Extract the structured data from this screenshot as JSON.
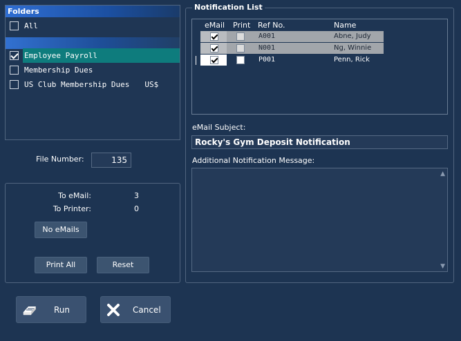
{
  "folders": {
    "header": "Folders",
    "items": [
      {
        "label": "All",
        "checked": false
      },
      {
        "label": "Employee Payroll",
        "checked": true,
        "selected": true
      },
      {
        "label": "Membership Dues",
        "checked": false
      },
      {
        "label": "US Club Membership Dues",
        "suffix": "US$",
        "checked": false
      }
    ]
  },
  "file_number": {
    "label": "File Number:",
    "value": "135"
  },
  "counts": {
    "to_email_label": "To eMail:",
    "to_email_value": "3",
    "to_printer_label": "To Printer:",
    "to_printer_value": "0",
    "no_emails_label": "No eMails",
    "print_all_label": "Print All",
    "reset_label": "Reset"
  },
  "notification_list": {
    "title": "Notification List",
    "columns": [
      "eMail",
      "Print",
      "Ref No.",
      "Name"
    ],
    "rows": [
      {
        "email": true,
        "print": false,
        "ref": "A001",
        "name": "Abne, Judy"
      },
      {
        "email": true,
        "print": false,
        "ref": "N001",
        "name": "Ng, Winnie"
      },
      {
        "email": true,
        "print": false,
        "ref": "P001",
        "name": "Penn, Rick"
      }
    ]
  },
  "email_subject": {
    "label": "eMail Subject:",
    "value": "Rocky's Gym Deposit Notification"
  },
  "additional_message": {
    "label": "Additional Notification Message:",
    "value": ""
  },
  "actions": {
    "run_label": "Run",
    "cancel_label": "Cancel"
  },
  "icons": {
    "run": "eraser-icon",
    "cancel": "x-close-icon"
  },
  "colors": {
    "background": "#1d3452",
    "selected_row": "#0e7c7d",
    "header_blue": "#2f6ed3"
  }
}
